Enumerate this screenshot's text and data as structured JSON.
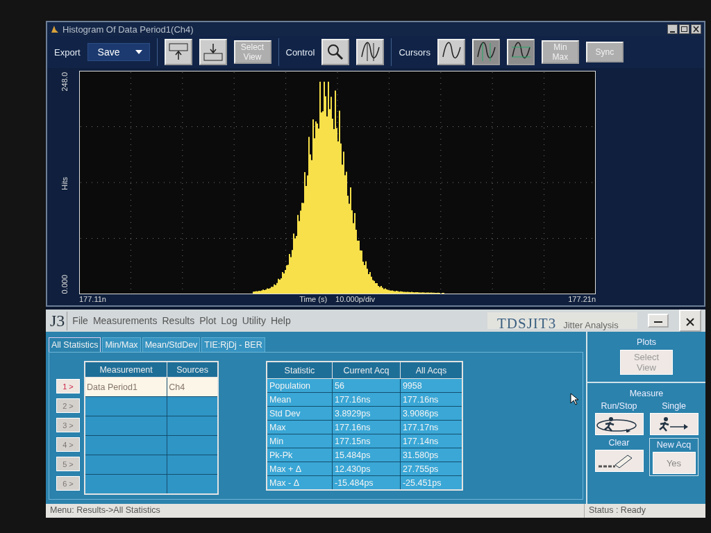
{
  "histogram_window": {
    "title": "Histogram Of Data Period1(Ch4)",
    "toolbar": [
      {
        "kind": "label",
        "text": "Export"
      },
      {
        "kind": "dropdown",
        "text": "Save"
      },
      {
        "kind": "sep"
      },
      {
        "kind": "icon_button"
      },
      {
        "kind": "icon_button"
      },
      {
        "kind": "button",
        "text": "Select View",
        "disabled": true
      },
      {
        "kind": "sep"
      },
      {
        "kind": "label",
        "text": "Control"
      },
      {
        "kind": "icon_button"
      },
      {
        "kind": "icon_button"
      },
      {
        "kind": "sep"
      },
      {
        "kind": "label",
        "text": "Cursors"
      },
      {
        "kind": "icon_button"
      },
      {
        "kind": "icon_button"
      },
      {
        "kind": "icon_button"
      },
      {
        "kind": "button",
        "text": "Min Max",
        "disabled": true
      },
      {
        "kind": "button",
        "text": "Sync",
        "disabled": true
      }
    ],
    "plot": {
      "y_label": "Hits",
      "y_max": "248.0",
      "y_min": "0.000",
      "x_min": "177.11n",
      "x_title": "Time (s)",
      "x_scale": "10.000p/div",
      "x_max": "177.21n"
    }
  },
  "jitter_app": {
    "logo": "J3",
    "menu": [
      "File",
      "Measurements",
      "Results",
      "Plot",
      "Log",
      "Utility",
      "Help"
    ],
    "product": "TDSJIT3",
    "subtitle": "Jitter Analysis",
    "tabs": [
      {
        "label": "All Statistics",
        "selected": true
      },
      {
        "label": "Min/Max",
        "selected": false
      },
      {
        "label": "Mean/StdDev",
        "selected": false
      },
      {
        "label": "TIE:RjDj - BER",
        "selected": false
      }
    ],
    "measurements": {
      "columns": [
        "Measurement",
        "Sources"
      ],
      "rows": [
        {
          "button": "1 >",
          "disabled": false,
          "selected": true,
          "measurement": "Data Period1",
          "source": "Ch4"
        },
        {
          "button": "2 >",
          "disabled": true,
          "selected": false
        },
        {
          "button": "3 >",
          "disabled": true,
          "selected": false
        },
        {
          "button": "4 >",
          "disabled": true,
          "selected": false
        },
        {
          "button": "5 >",
          "disabled": true,
          "selected": false
        },
        {
          "button": "6 >",
          "disabled": true,
          "selected": false
        }
      ]
    },
    "statistics": {
      "columns": [
        "Statistic",
        "Current Acq",
        "All Acqs"
      ],
      "rows": [
        [
          "Population",
          "56",
          "9958"
        ],
        [
          "Mean",
          "177.16ns",
          "177.16ns"
        ],
        [
          "Std Dev",
          "3.8929ps",
          "3.9086ps"
        ],
        [
          "Max",
          "177.16ns",
          "177.17ns"
        ],
        [
          "Min",
          "177.15ns",
          "177.14ns"
        ],
        [
          "Pk-Pk",
          "15.484ps",
          "31.580ps"
        ],
        [
          "Max + Δ",
          "12.430ps",
          "27.755ps"
        ],
        [
          "Max - Δ",
          "-15.484ps",
          "-25.451ps"
        ]
      ]
    },
    "plots": {
      "title": "Plots",
      "button": "Select View"
    },
    "measure": {
      "title": "Measure",
      "run_stop": "Run/Stop",
      "single": "Single",
      "clear": "Clear",
      "new_acq": "New Acq",
      "new_acq_button": "Yes"
    },
    "status_bar": {
      "menu": "Menu: Results->All Statistics",
      "status": "Status : Ready"
    }
  }
}
